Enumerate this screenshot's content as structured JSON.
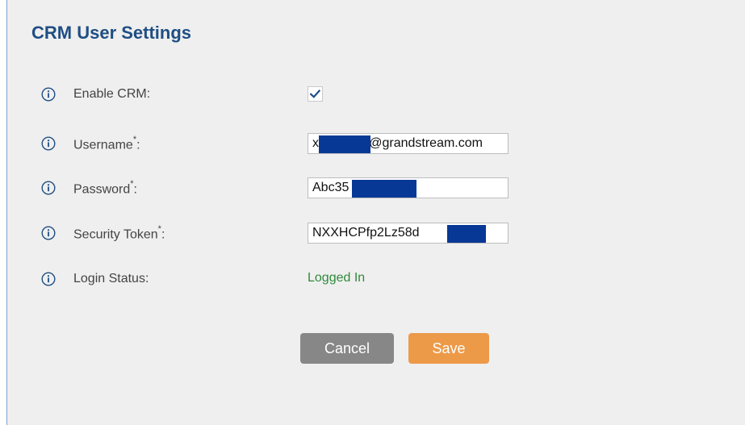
{
  "section": {
    "title": "CRM User Settings"
  },
  "fields": {
    "enable_crm": {
      "label": "Enable CRM:",
      "checked": true,
      "icon": "info-icon"
    },
    "username": {
      "label": "Username",
      "required_mark": "*",
      "suffix": ":",
      "value": "x            g@grandstream.com",
      "icon": "info-icon"
    },
    "password": {
      "label": "Password",
      "required_mark": "*",
      "suffix": ":",
      "value": "Abc35",
      "icon": "info-icon"
    },
    "security_token": {
      "label": "Security Token",
      "required_mark": "*",
      "suffix": ":",
      "value": "NXXHCPfp2Lz58d            4G",
      "icon": "info-icon"
    },
    "login_status": {
      "label": "Login Status:",
      "value": "Logged In",
      "icon": "info-icon"
    }
  },
  "buttons": {
    "cancel": "Cancel",
    "save": "Save"
  },
  "colors": {
    "title": "#1f4e84",
    "status_ok": "#2f8a3a",
    "cancel_button": "#878787",
    "save_button": "#ec9a48",
    "redaction": "#083896",
    "icon_blue": "#1f4e84"
  }
}
